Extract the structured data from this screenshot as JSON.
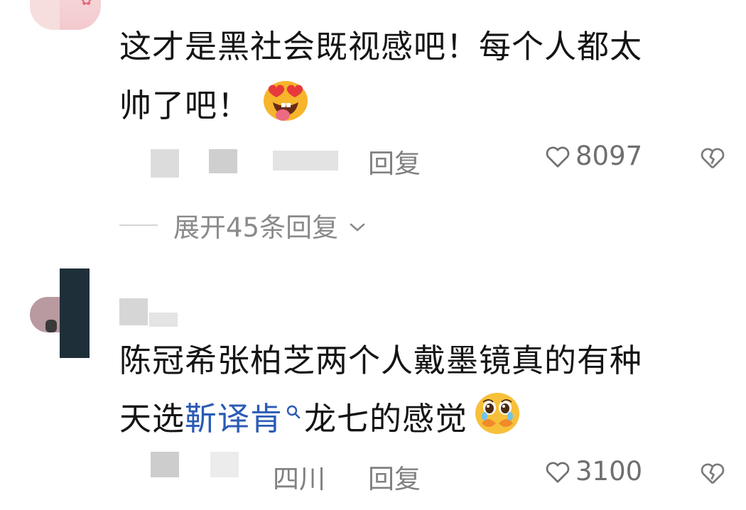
{
  "comments": [
    {
      "text_line1": "这才是黑社会既视感吧！每个人都太",
      "text_line2": "帅了吧！",
      "emoji_icon": "heart-eyes-tongue-emoji",
      "reply_label": "回复",
      "like_count": "8097",
      "expand_label": "展开45条回复"
    },
    {
      "text_line1": "陈冠希张柏芝两个人戴墨镜真的有种",
      "text_prefix": "天选",
      "link_text": "靳译肯",
      "text_suffix": "龙七的感觉",
      "emoji_icon": "pleading-teary-emoji",
      "location": "四川",
      "reply_label": "回复",
      "like_count": "3100"
    }
  ]
}
